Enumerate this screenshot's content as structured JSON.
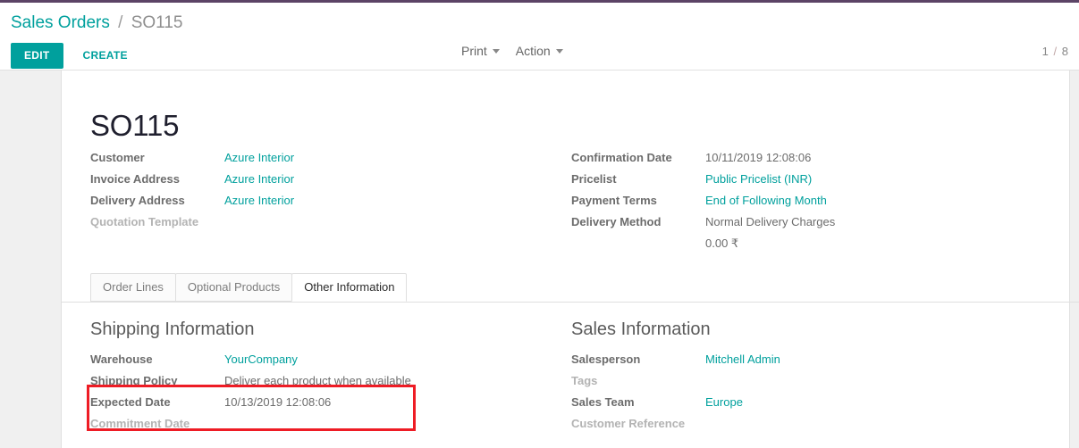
{
  "theme": {
    "accent": "#00A09D",
    "top_bar": "#5c4466",
    "link": "#00A09D",
    "highlight_box": "#ee1c25",
    "label": "#6c6c6c",
    "empty_label": "#b3b3b3"
  },
  "control_panel": {
    "breadcrumb": {
      "parent": "Sales Orders",
      "separator": "/",
      "current": "SO115"
    },
    "edit_label": "EDIT",
    "create_label": "CREATE",
    "print_label": "Print",
    "action_label": "Action",
    "pager": {
      "current": "1",
      "separator": "/",
      "total": "8",
      "text": "1 / 8"
    }
  },
  "record": {
    "title": "SO115",
    "left_fields": [
      {
        "label": "Customer",
        "value": "Azure Interior",
        "is_link": true,
        "empty": false
      },
      {
        "label": "Invoice Address",
        "value": "Azure Interior",
        "is_link": true,
        "empty": false
      },
      {
        "label": "Delivery Address",
        "value": "Azure Interior",
        "is_link": true,
        "empty": false
      },
      {
        "label": "Quotation Template",
        "value": "",
        "is_link": false,
        "empty": true
      }
    ],
    "right_fields": [
      {
        "label": "Confirmation Date",
        "value": "10/11/2019 12:08:06",
        "is_link": false,
        "empty": false
      },
      {
        "label": "Pricelist",
        "value": "Public Pricelist (INR)",
        "is_link": true,
        "empty": false
      },
      {
        "label": "Payment Terms",
        "value": "End of Following Month",
        "is_link": true,
        "empty": false
      },
      {
        "label": "Delivery Method",
        "value": "Normal Delivery Charges",
        "value2": "0.00 ₹",
        "is_link": false,
        "empty": false
      }
    ]
  },
  "notebook": {
    "tabs": [
      {
        "label": "Order Lines",
        "active": false
      },
      {
        "label": "Optional Products",
        "active": false
      },
      {
        "label": "Other Information",
        "active": true
      }
    ]
  },
  "other_information": {
    "shipping": {
      "title": "Shipping Information",
      "fields": [
        {
          "label": "Warehouse",
          "value": "YourCompany",
          "is_link": true,
          "empty": false
        },
        {
          "label": "Shipping Policy",
          "value": "Deliver each product when available",
          "is_link": false,
          "empty": false
        },
        {
          "label": "Expected Date",
          "value": "10/13/2019 12:08:06",
          "is_link": false,
          "empty": false
        },
        {
          "label": "Commitment Date",
          "value": "",
          "is_link": false,
          "empty": true
        }
      ]
    },
    "sales": {
      "title": "Sales Information",
      "fields": [
        {
          "label": "Salesperson",
          "value": "Mitchell Admin",
          "is_link": true,
          "empty": false
        },
        {
          "label": "Tags",
          "value": "",
          "is_link": false,
          "empty": true
        },
        {
          "label": "Sales Team",
          "value": "Europe",
          "is_link": true,
          "empty": false
        },
        {
          "label": "Customer Reference",
          "value": "",
          "is_link": false,
          "empty": true
        }
      ]
    }
  }
}
